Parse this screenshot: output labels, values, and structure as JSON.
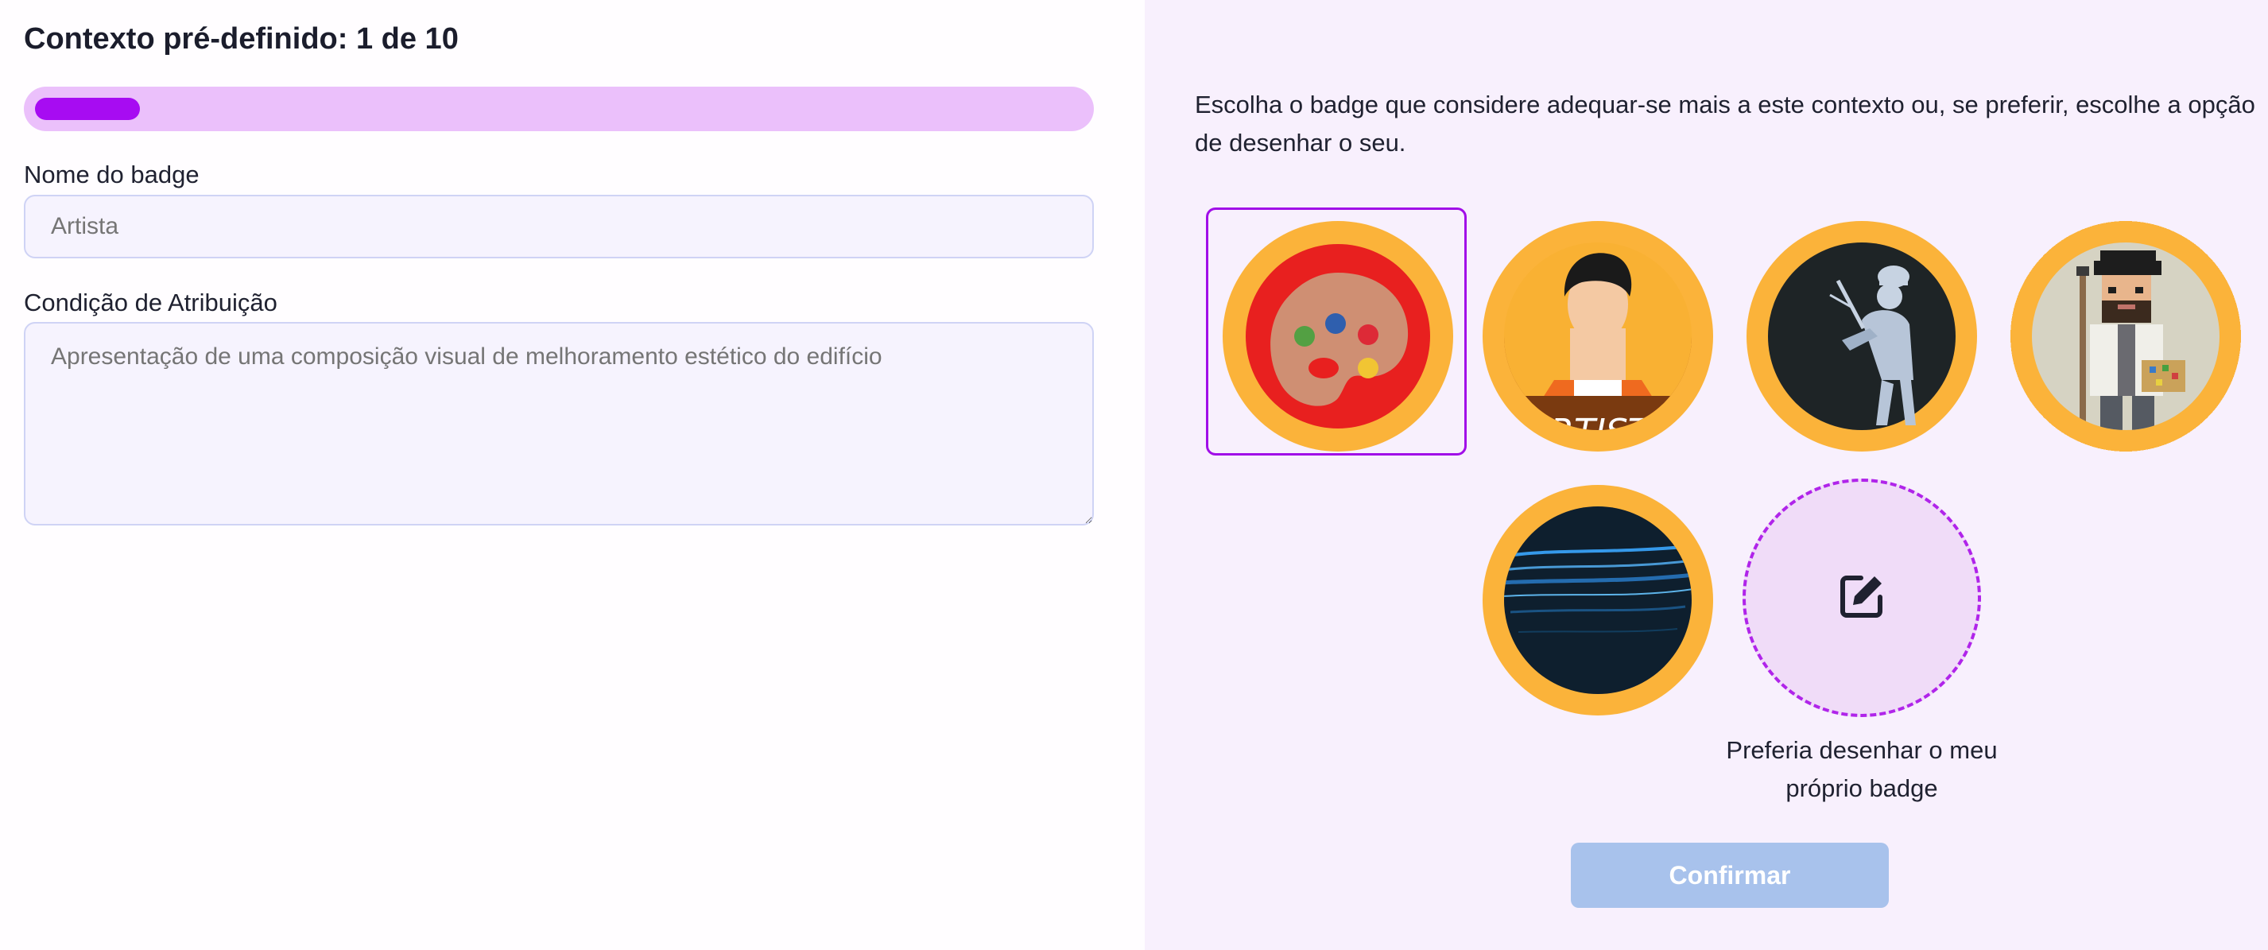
{
  "header": {
    "title": "Contexto pré-definido: 1 de 10",
    "progress": 0.1
  },
  "form": {
    "name_label": "Nome do badge",
    "name_value": "Artista",
    "condition_label": "Condição de Atribuição",
    "condition_value": "Apresentação de uma composição visual de melhoramento estético do edifício"
  },
  "chooser": {
    "instructions": "Escolha o badge que considere adequar-se mais a este contexto ou, se preferir, escolhe a opção de desenhar o seu.",
    "badges": [
      {
        "name": "paint-palette",
        "selected": true
      },
      {
        "name": "artist-person",
        "selected": false,
        "text": "ARTISTA"
      },
      {
        "name": "painter-sketch",
        "selected": false
      },
      {
        "name": "pixel-painter",
        "selected": false
      },
      {
        "name": "blue-light-streaks",
        "selected": false
      }
    ],
    "draw_own_label": "Preferia desenhar o meu próprio badge",
    "draw_icon": "edit-icon",
    "confirm_label": "Confirmar"
  },
  "colors": {
    "accent": "#a70cf2",
    "badge_ring": "#fbb33a",
    "confirm_disabled": "#a8c2ec"
  }
}
